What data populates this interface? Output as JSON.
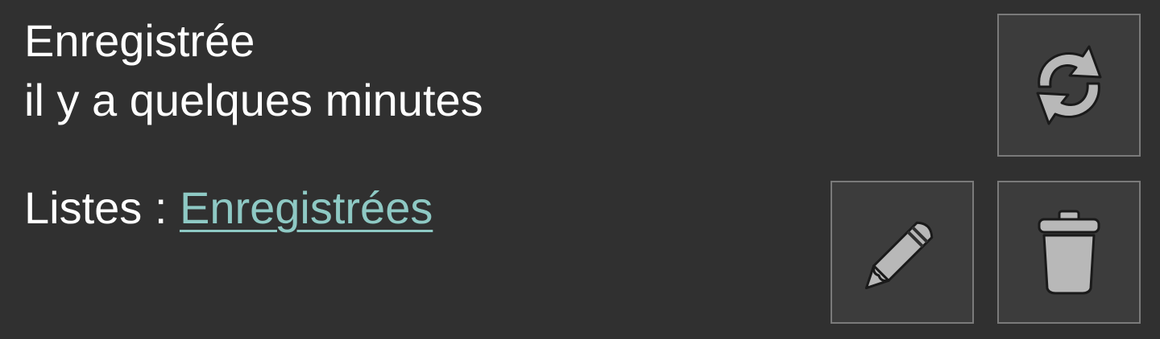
{
  "status": {
    "title": "Enregistrée",
    "time": "il y a quelques minutes"
  },
  "lists": {
    "label": "Listes :",
    "link": "Enregistrées"
  },
  "actions": {
    "refresh_icon": "refresh-icon",
    "edit_icon": "pencil-icon",
    "delete_icon": "trash-icon"
  },
  "colors": {
    "background": "#303030",
    "button_background": "#3c3c3c",
    "button_border": "#7a7a7a",
    "icon": "#b8b8b8",
    "link": "#8ec9c4",
    "text": "#ffffff"
  }
}
